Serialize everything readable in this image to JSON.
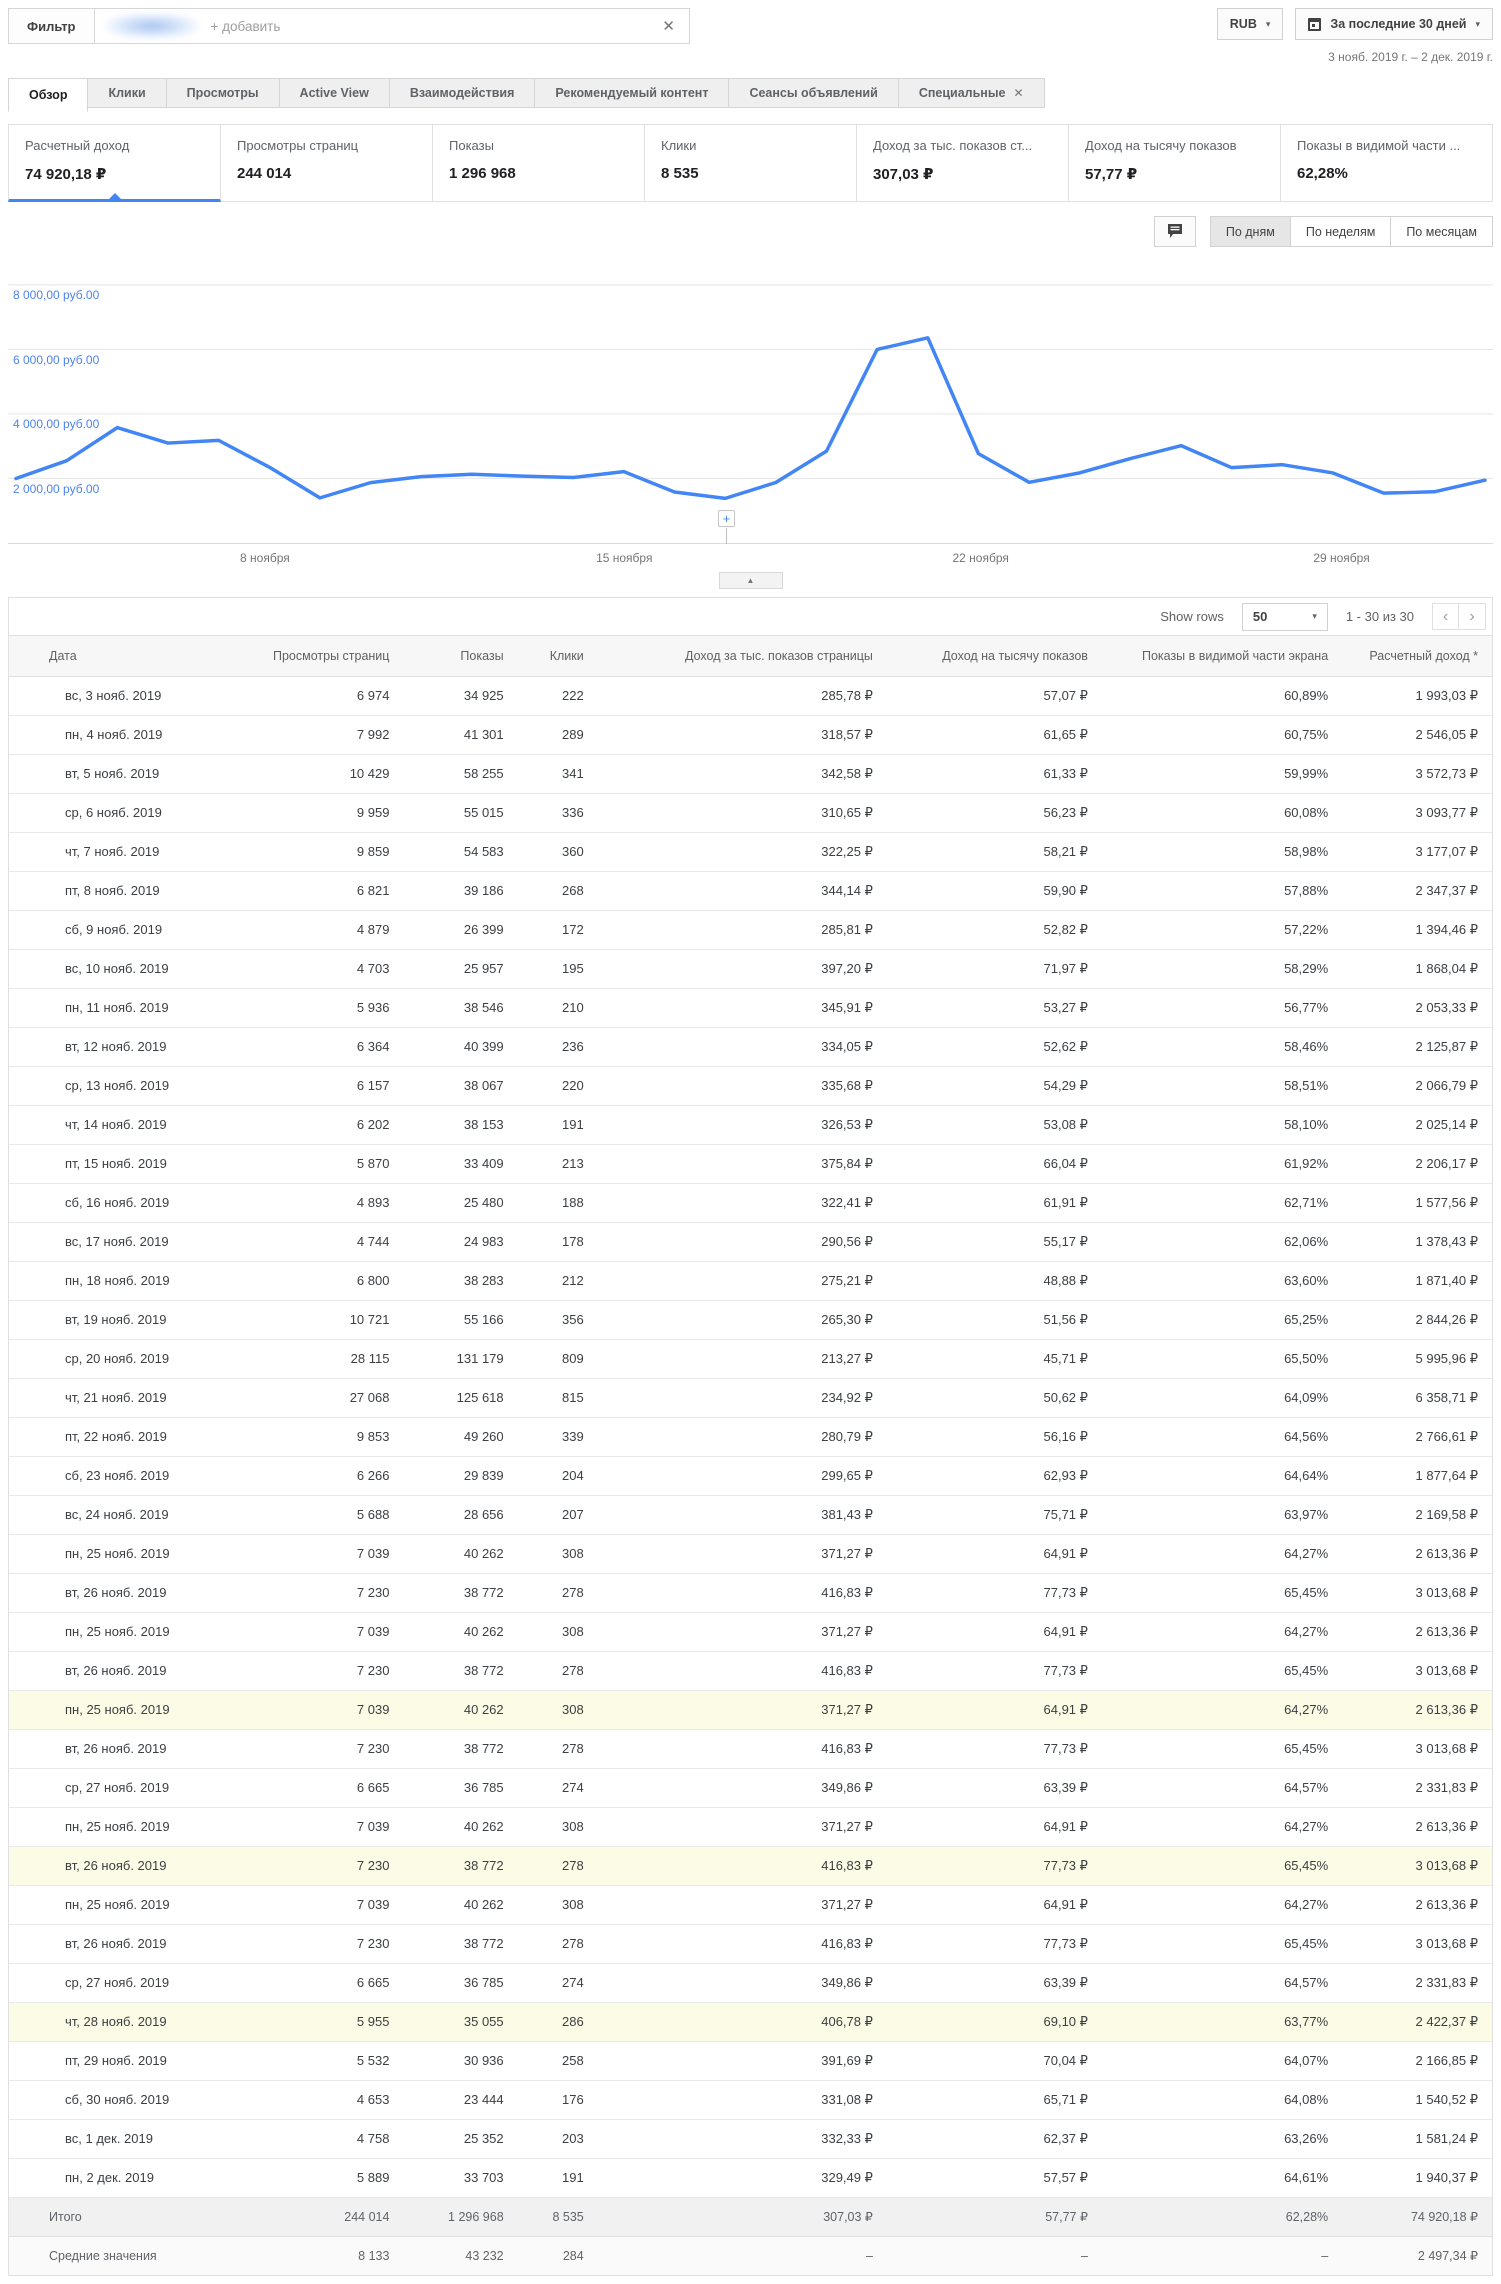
{
  "icons": {
    "close": "✕",
    "caret_down": "▾",
    "chevron_left": "‹",
    "chevron_right": "›",
    "collapse": "▲",
    "plus": "+"
  },
  "colors": {
    "accent": "#4285f4",
    "axis_label": "#4e83ec",
    "row_highlight": "#fcfbe6"
  },
  "topbar": {
    "filter_label": "Фильтр",
    "filter_placeholder": "+ добавить",
    "currency": "RUB",
    "date_range_button": "За последние 30 дней",
    "date_range_text": "3 нояб. 2019 г. – 2 дек. 2019 г."
  },
  "tabs": [
    {
      "label": "Обзор"
    },
    {
      "label": "Клики"
    },
    {
      "label": "Просмотры"
    },
    {
      "label": "Active View"
    },
    {
      "label": "Взаимодействия"
    },
    {
      "label": "Рекомендуемый контент"
    },
    {
      "label": "Сеансы объявлений"
    },
    {
      "label": "Специальные"
    }
  ],
  "cards": [
    {
      "label": "Расчетный доход",
      "value": "74 920,18 ₽"
    },
    {
      "label": "Просмотры страниц",
      "value": "244 014"
    },
    {
      "label": "Показы",
      "value": "1 296 968"
    },
    {
      "label": "Клики",
      "value": "8 535"
    },
    {
      "label": "Доход за тыс. показов ст...",
      "value": "307,03 ₽"
    },
    {
      "label": "Доход на тысячу показов",
      "value": "57,77 ₽"
    },
    {
      "label": "Показы в видимой части ...",
      "value": "62,28%"
    }
  ],
  "chart_controls": {
    "daily": "По дням",
    "weekly": "По неделям",
    "monthly": "По месяцам"
  },
  "chart_data": {
    "type": "line",
    "title": "Расчетный доход по дням",
    "x": [
      "3 нояб.",
      "4 нояб.",
      "5 нояб.",
      "6 нояб.",
      "7 нояб.",
      "8 нояб.",
      "9 нояб.",
      "10 нояб.",
      "11 нояб.",
      "12 нояб.",
      "13 нояб.",
      "14 нояб.",
      "15 нояб.",
      "16 нояб.",
      "17 нояб.",
      "18 нояб.",
      "19 нояб.",
      "20 нояб.",
      "21 нояб.",
      "22 нояб.",
      "23 нояб.",
      "24 нояб.",
      "25 нояб.",
      "26 нояб.",
      "27 нояб.",
      "28 нояб.",
      "29 нояб.",
      "30 нояб.",
      "1 дек.",
      "2 дек."
    ],
    "values": [
      1993.03,
      2546.05,
      3572.73,
      3093.77,
      3177.07,
      2347.37,
      1394.46,
      1868.04,
      2053.33,
      2125.87,
      2066.79,
      2025.14,
      2206.17,
      1577.56,
      1378.43,
      1871.4,
      2844.26,
      5995.96,
      6358.71,
      2766.61,
      1877.64,
      2169.58,
      2613.36,
      3013.68,
      2331.83,
      2422.37,
      2166.85,
      1540.52,
      1581.24,
      1940.37
    ],
    "grid_values": [
      8000,
      6000,
      4000,
      2000
    ],
    "y_tick_labels": [
      "8 000,00 руб.00",
      "6 000,00 руб.00",
      "4 000,00 руб.00",
      "2 000,00 руб.00"
    ],
    "x_tick_labels": [
      "8 ноября",
      "15 ноября",
      "22 ноября",
      "29 ноября"
    ],
    "ylim": [
      0,
      8750
    ],
    "legend": "none",
    "grid": true
  },
  "table": {
    "show_rows_label": "Show rows",
    "page_size": "50",
    "range_text": "1 - 30 из 30",
    "headers": [
      "Дата",
      "Просмотры страниц",
      "Показы",
      "Клики",
      "Доход за тыс. показов страницы",
      "Доход на тысячу показов",
      "Показы в видимой части экрана",
      "Расчетный доход *"
    ],
    "rows": [
      {
        "c": [
          "вс, 3 нояб. 2019",
          "6 974",
          "34 925",
          "222",
          "285,78 ₽",
          "57,07 ₽",
          "60,89%",
          "1 993,03 ₽"
        ],
        "hl": false
      },
      {
        "c": [
          "пн, 4 нояб. 2019",
          "7 992",
          "41 301",
          "289",
          "318,57 ₽",
          "61,65 ₽",
          "60,75%",
          "2 546,05 ₽"
        ],
        "hl": false
      },
      {
        "c": [
          "вт, 5 нояб. 2019",
          "10 429",
          "58 255",
          "341",
          "342,58 ₽",
          "61,33 ₽",
          "59,99%",
          "3 572,73 ₽"
        ],
        "hl": false
      },
      {
        "c": [
          "ср, 6 нояб. 2019",
          "9 959",
          "55 015",
          "336",
          "310,65 ₽",
          "56,23 ₽",
          "60,08%",
          "3 093,77 ₽"
        ],
        "hl": false
      },
      {
        "c": [
          "чт, 7 нояб. 2019",
          "9 859",
          "54 583",
          "360",
          "322,25 ₽",
          "58,21 ₽",
          "58,98%",
          "3 177,07 ₽"
        ],
        "hl": false
      },
      {
        "c": [
          "пт, 8 нояб. 2019",
          "6 821",
          "39 186",
          "268",
          "344,14 ₽",
          "59,90 ₽",
          "57,88%",
          "2 347,37 ₽"
        ],
        "hl": false
      },
      {
        "c": [
          "сб, 9 нояб. 2019",
          "4 879",
          "26 399",
          "172",
          "285,81 ₽",
          "52,82 ₽",
          "57,22%",
          "1 394,46 ₽"
        ],
        "hl": false
      },
      {
        "c": [
          "вс, 10 нояб. 2019",
          "4 703",
          "25 957",
          "195",
          "397,20 ₽",
          "71,97 ₽",
          "58,29%",
          "1 868,04 ₽"
        ],
        "hl": false
      },
      {
        "c": [
          "пн, 11 нояб. 2019",
          "5 936",
          "38 546",
          "210",
          "345,91 ₽",
          "53,27 ₽",
          "56,77%",
          "2 053,33 ₽"
        ],
        "hl": false
      },
      {
        "c": [
          "вт, 12 нояб. 2019",
          "6 364",
          "40 399",
          "236",
          "334,05 ₽",
          "52,62 ₽",
          "58,46%",
          "2 125,87 ₽"
        ],
        "hl": false
      },
      {
        "c": [
          "ср, 13 нояб. 2019",
          "6 157",
          "38 067",
          "220",
          "335,68 ₽",
          "54,29 ₽",
          "58,51%",
          "2 066,79 ₽"
        ],
        "hl": false
      },
      {
        "c": [
          "чт, 14 нояб. 2019",
          "6 202",
          "38 153",
          "191",
          "326,53 ₽",
          "53,08 ₽",
          "58,10%",
          "2 025,14 ₽"
        ],
        "hl": false
      },
      {
        "c": [
          "пт, 15 нояб. 2019",
          "5 870",
          "33 409",
          "213",
          "375,84 ₽",
          "66,04 ₽",
          "61,92%",
          "2 206,17 ₽"
        ],
        "hl": false
      },
      {
        "c": [
          "сб, 16 нояб. 2019",
          "4 893",
          "25 480",
          "188",
          "322,41 ₽",
          "61,91 ₽",
          "62,71%",
          "1 577,56 ₽"
        ],
        "hl": false
      },
      {
        "c": [
          "вс, 17 нояб. 2019",
          "4 744",
          "24 983",
          "178",
          "290,56 ₽",
          "55,17 ₽",
          "62,06%",
          "1 378,43 ₽"
        ],
        "hl": false
      },
      {
        "c": [
          "пн, 18 нояб. 2019",
          "6 800",
          "38 283",
          "212",
          "275,21 ₽",
          "48,88 ₽",
          "63,60%",
          "1 871,40 ₽"
        ],
        "hl": false
      },
      {
        "c": [
          "вт, 19 нояб. 2019",
          "10 721",
          "55 166",
          "356",
          "265,30 ₽",
          "51,56 ₽",
          "65,25%",
          "2 844,26 ₽"
        ],
        "hl": false
      },
      {
        "c": [
          "ср, 20 нояб. 2019",
          "28 115",
          "131 179",
          "809",
          "213,27 ₽",
          "45,71 ₽",
          "65,50%",
          "5 995,96 ₽"
        ],
        "hl": false
      },
      {
        "c": [
          "чт, 21 нояб. 2019",
          "27 068",
          "125 618",
          "815",
          "234,92 ₽",
          "50,62 ₽",
          "64,09%",
          "6 358,71 ₽"
        ],
        "hl": false
      },
      {
        "c": [
          "пт, 22 нояб. 2019",
          "9 853",
          "49 260",
          "339",
          "280,79 ₽",
          "56,16 ₽",
          "64,56%",
          "2 766,61 ₽"
        ],
        "hl": false
      },
      {
        "c": [
          "сб, 23 нояб. 2019",
          "6 266",
          "29 839",
          "204",
          "299,65 ₽",
          "62,93 ₽",
          "64,64%",
          "1 877,64 ₽"
        ],
        "hl": false
      },
      {
        "c": [
          "вс, 24 нояб. 2019",
          "5 688",
          "28 656",
          "207",
          "381,43 ₽",
          "75,71 ₽",
          "63,97%",
          "2 169,58 ₽"
        ],
        "hl": false
      },
      {
        "c": [
          "пн, 25 нояб. 2019",
          "7 039",
          "40 262",
          "308",
          "371,27 ₽",
          "64,91 ₽",
          "64,27%",
          "2 613,36 ₽"
        ],
        "hl": false
      },
      {
        "c": [
          "вт, 26 нояб. 2019",
          "7 230",
          "38 772",
          "278",
          "416,83 ₽",
          "77,73 ₽",
          "65,45%",
          "3 013,68 ₽"
        ],
        "hl": false
      },
      {
        "c": [
          "пн, 25 нояб. 2019",
          "7 039",
          "40 262",
          "308",
          "371,27 ₽",
          "64,91 ₽",
          "64,27%",
          "2 613,36 ₽"
        ],
        "hl": false
      },
      {
        "c": [
          "вт, 26 нояб. 2019",
          "7 230",
          "38 772",
          "278",
          "416,83 ₽",
          "77,73 ₽",
          "65,45%",
          "3 013,68 ₽"
        ],
        "hl": false
      },
      {
        "c": [
          "пн, 25 нояб. 2019",
          "7 039",
          "40 262",
          "308",
          "371,27 ₽",
          "64,91 ₽",
          "64,27%",
          "2 613,36 ₽"
        ],
        "hl": true
      },
      {
        "c": [
          "вт, 26 нояб. 2019",
          "7 230",
          "38 772",
          "278",
          "416,83 ₽",
          "77,73 ₽",
          "65,45%",
          "3 013,68 ₽"
        ],
        "hl": false
      },
      {
        "c": [
          "ср, 27 нояб. 2019",
          "6 665",
          "36 785",
          "274",
          "349,86 ₽",
          "63,39 ₽",
          "64,57%",
          "2 331,83 ₽"
        ],
        "hl": false
      },
      {
        "c": [
          "пн, 25 нояб. 2019",
          "7 039",
          "40 262",
          "308",
          "371,27 ₽",
          "64,91 ₽",
          "64,27%",
          "2 613,36 ₽"
        ],
        "hl": false
      },
      {
        "c": [
          "вт, 26 нояб. 2019",
          "7 230",
          "38 772",
          "278",
          "416,83 ₽",
          "77,73 ₽",
          "65,45%",
          "3 013,68 ₽"
        ],
        "hl": true
      },
      {
        "c": [
          "пн, 25 нояб. 2019",
          "7 039",
          "40 262",
          "308",
          "371,27 ₽",
          "64,91 ₽",
          "64,27%",
          "2 613,36 ₽"
        ],
        "hl": false
      },
      {
        "c": [
          "вт, 26 нояб. 2019",
          "7 230",
          "38 772",
          "278",
          "416,83 ₽",
          "77,73 ₽",
          "65,45%",
          "3 013,68 ₽"
        ],
        "hl": false
      },
      {
        "c": [
          "ср, 27 нояб. 2019",
          "6 665",
          "36 785",
          "274",
          "349,86 ₽",
          "63,39 ₽",
          "64,57%",
          "2 331,83 ₽"
        ],
        "hl": false
      },
      {
        "c": [
          "чт, 28 нояб. 2019",
          "5 955",
          "35 055",
          "286",
          "406,78 ₽",
          "69,10 ₽",
          "63,77%",
          "2 422,37 ₽"
        ],
        "hl": true
      },
      {
        "c": [
          "пт, 29 нояб. 2019",
          "5 532",
          "30 936",
          "258",
          "391,69 ₽",
          "70,04 ₽",
          "64,07%",
          "2 166,85 ₽"
        ],
        "hl": false
      },
      {
        "c": [
          "сб, 30 нояб. 2019",
          "4 653",
          "23 444",
          "176",
          "331,08 ₽",
          "65,71 ₽",
          "64,08%",
          "1 540,52 ₽"
        ],
        "hl": false
      },
      {
        "c": [
          "вс, 1 дек. 2019",
          "4 758",
          "25 352",
          "203",
          "332,33 ₽",
          "62,37 ₽",
          "63,26%",
          "1 581,24 ₽"
        ],
        "hl": false
      },
      {
        "c": [
          "пн, 2 дек. 2019",
          "5 889",
          "33 703",
          "191",
          "329,49 ₽",
          "57,57 ₽",
          "64,61%",
          "1 940,37 ₽"
        ],
        "hl": false
      }
    ],
    "footer": [
      {
        "c": [
          "Итого",
          "244 014",
          "1 296 968",
          "8 535",
          "307,03 ₽",
          "57,77 ₽",
          "62,28%",
          "74 920,18 ₽"
        ],
        "kind": "total"
      },
      {
        "c": [
          "Средние значения",
          "8 133",
          "43 232",
          "284",
          "–",
          "–",
          "–",
          "2 497,34 ₽"
        ],
        "kind": "avg"
      }
    ]
  }
}
